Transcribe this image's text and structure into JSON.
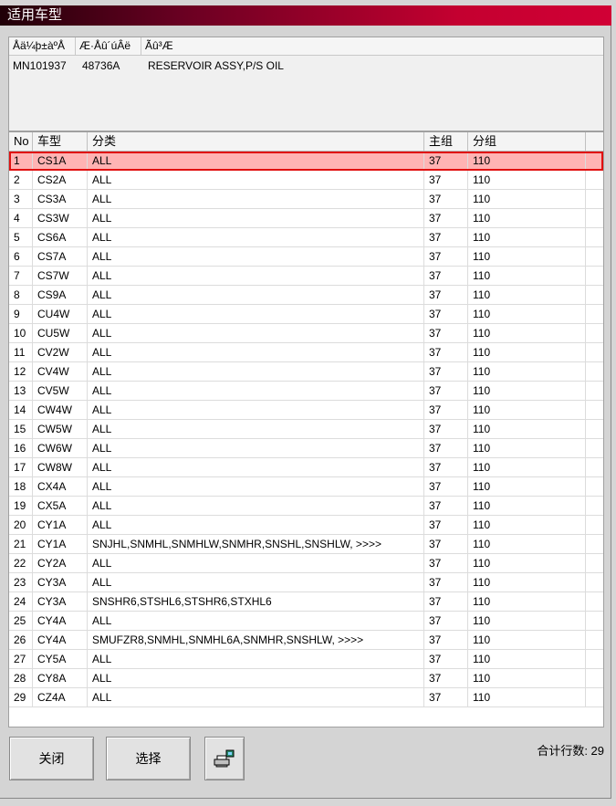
{
  "window": {
    "title": "适用车型"
  },
  "info": {
    "headers": [
      "Åä¼þ±àºÅ",
      "Æ·Åû´úÂë",
      "Ãû³Æ"
    ],
    "values": [
      "MN101937",
      "48736A",
      "RESERVOIR ASSY,P/S OIL"
    ]
  },
  "table": {
    "headers": [
      "No",
      "车型",
      "分类",
      "主组",
      "分组"
    ],
    "rows": [
      [
        "1",
        "CS1A",
        "ALL",
        "37",
        "110"
      ],
      [
        "2",
        "CS2A",
        "ALL",
        "37",
        "110"
      ],
      [
        "3",
        "CS3A",
        "ALL",
        "37",
        "110"
      ],
      [
        "4",
        "CS3W",
        "ALL",
        "37",
        "110"
      ],
      [
        "5",
        "CS6A",
        "ALL",
        "37",
        "110"
      ],
      [
        "6",
        "CS7A",
        "ALL",
        "37",
        "110"
      ],
      [
        "7",
        "CS7W",
        "ALL",
        "37",
        "110"
      ],
      [
        "8",
        "CS9A",
        "ALL",
        "37",
        "110"
      ],
      [
        "9",
        "CU4W",
        "ALL",
        "37",
        "110"
      ],
      [
        "10",
        "CU5W",
        "ALL",
        "37",
        "110"
      ],
      [
        "11",
        "CV2W",
        "ALL",
        "37",
        "110"
      ],
      [
        "12",
        "CV4W",
        "ALL",
        "37",
        "110"
      ],
      [
        "13",
        "CV5W",
        "ALL",
        "37",
        "110"
      ],
      [
        "14",
        "CW4W",
        "ALL",
        "37",
        "110"
      ],
      [
        "15",
        "CW5W",
        "ALL",
        "37",
        "110"
      ],
      [
        "16",
        "CW6W",
        "ALL",
        "37",
        "110"
      ],
      [
        "17",
        "CW8W",
        "ALL",
        "37",
        "110"
      ],
      [
        "18",
        "CX4A",
        "ALL",
        "37",
        "110"
      ],
      [
        "19",
        "CX5A",
        "ALL",
        "37",
        "110"
      ],
      [
        "20",
        "CY1A",
        "ALL",
        "37",
        "110"
      ],
      [
        "21",
        "CY1A",
        "SNJHL,SNMHL,SNMHLW,SNMHR,SNSHL,SNSHLW,  >>>>",
        "37",
        "110"
      ],
      [
        "22",
        "CY2A",
        "ALL",
        "37",
        "110"
      ],
      [
        "23",
        "CY3A",
        "ALL",
        "37",
        "110"
      ],
      [
        "24",
        "CY3A",
        "SNSHR6,STSHL6,STSHR6,STXHL6",
        "37",
        "110"
      ],
      [
        "25",
        "CY4A",
        "ALL",
        "37",
        "110"
      ],
      [
        "26",
        "CY4A",
        "SMUFZR8,SNMHL,SNMHL6A,SNMHR,SNSHLW,  >>>>",
        "37",
        "110"
      ],
      [
        "27",
        "CY5A",
        "ALL",
        "37",
        "110"
      ],
      [
        "28",
        "CY8A",
        "ALL",
        "37",
        "110"
      ],
      [
        "29",
        "CZ4A",
        "ALL",
        "37",
        "110"
      ]
    ],
    "selected_index": 0
  },
  "buttons": {
    "close_label": "关闭",
    "select_label": "选择",
    "print_icon": "printer-icon"
  },
  "footer": {
    "total_label": "合计行数: 29"
  },
  "colors": {
    "selected_row_bg": "#ffb3b3",
    "selected_row_border": "#e01010",
    "title_bar_end": "#d10035"
  }
}
